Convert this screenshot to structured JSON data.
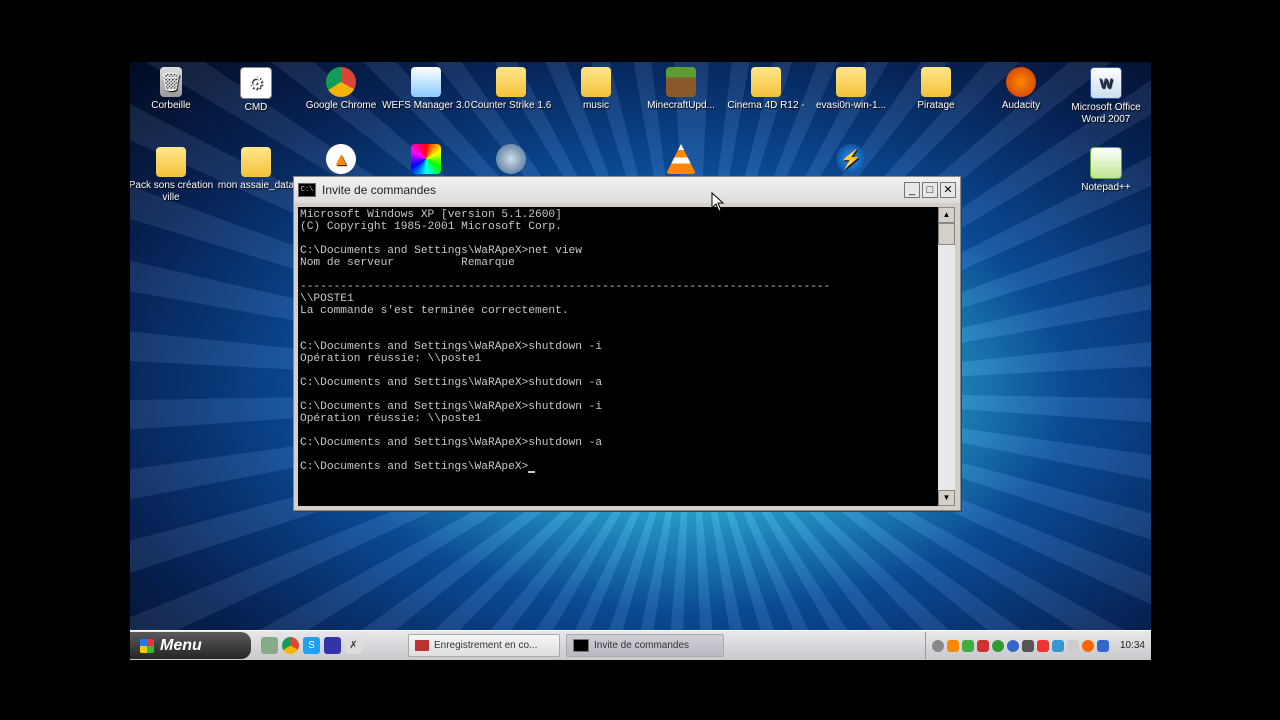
{
  "desktop": {
    "icons": [
      {
        "label": "Corbeille",
        "icon": "trash-icon"
      },
      {
        "label": "CMD",
        "icon": "cmd-icon"
      },
      {
        "label": "Google Chrome",
        "icon": "chrome-icon"
      },
      {
        "label": "WEFS Manager 3.0",
        "icon": "app-icon"
      },
      {
        "label": "Counter Strike 1.6",
        "icon": "folder-icon"
      },
      {
        "label": "music",
        "icon": "folder-icon"
      },
      {
        "label": "MinecraftUpd...",
        "icon": "minecraft-icon"
      },
      {
        "label": "Cinema 4D R12 -",
        "icon": "folder-icon"
      },
      {
        "label": "evasi0n-win-1...",
        "icon": "folder-icon"
      },
      {
        "label": "Piratage",
        "icon": "folder-icon"
      },
      {
        "label": "Audacity",
        "icon": "audacity-icon"
      },
      {
        "label": "Microsoft Office Word 2007",
        "icon": "word-icon"
      },
      {
        "label": "Pack sons création ville",
        "icon": "folder-icon"
      },
      {
        "label": "mon assaie_data",
        "icon": "folder-icon"
      },
      {
        "label": "Notepad++",
        "icon": "notepad-icon"
      }
    ]
  },
  "cmd_window": {
    "title": "Invite de commandes",
    "icon_text": "C:\\",
    "lines": [
      "Microsoft Windows XP [version 5.1.2600]",
      "(C) Copyright 1985-2001 Microsoft Corp.",
      "",
      "C:\\Documents and Settings\\WaRApeX>net view",
      "Nom de serveur          Remarque",
      "",
      "-------------------------------------------------------------------------------",
      "\\\\POSTE1",
      "La commande s'est terminée correctement.",
      "",
      "",
      "C:\\Documents and Settings\\WaRApeX>shutdown -i",
      "Opération réussie: \\\\poste1",
      "",
      "C:\\Documents and Settings\\WaRApeX>shutdown -a",
      "",
      "C:\\Documents and Settings\\WaRApeX>shutdown -i",
      "Opération réussie: \\\\poste1",
      "",
      "C:\\Documents and Settings\\WaRApeX>shutdown -a",
      "",
      "C:\\Documents and Settings\\WaRApeX>"
    ],
    "minimize": "_",
    "maximize": "□",
    "close": "✕"
  },
  "taskbar": {
    "start_label": "Menu",
    "tasks": [
      {
        "label": "Enregistrement en co...",
        "active": false
      },
      {
        "label": "Invite de commandes",
        "active": true
      }
    ],
    "clock": "10:34"
  }
}
